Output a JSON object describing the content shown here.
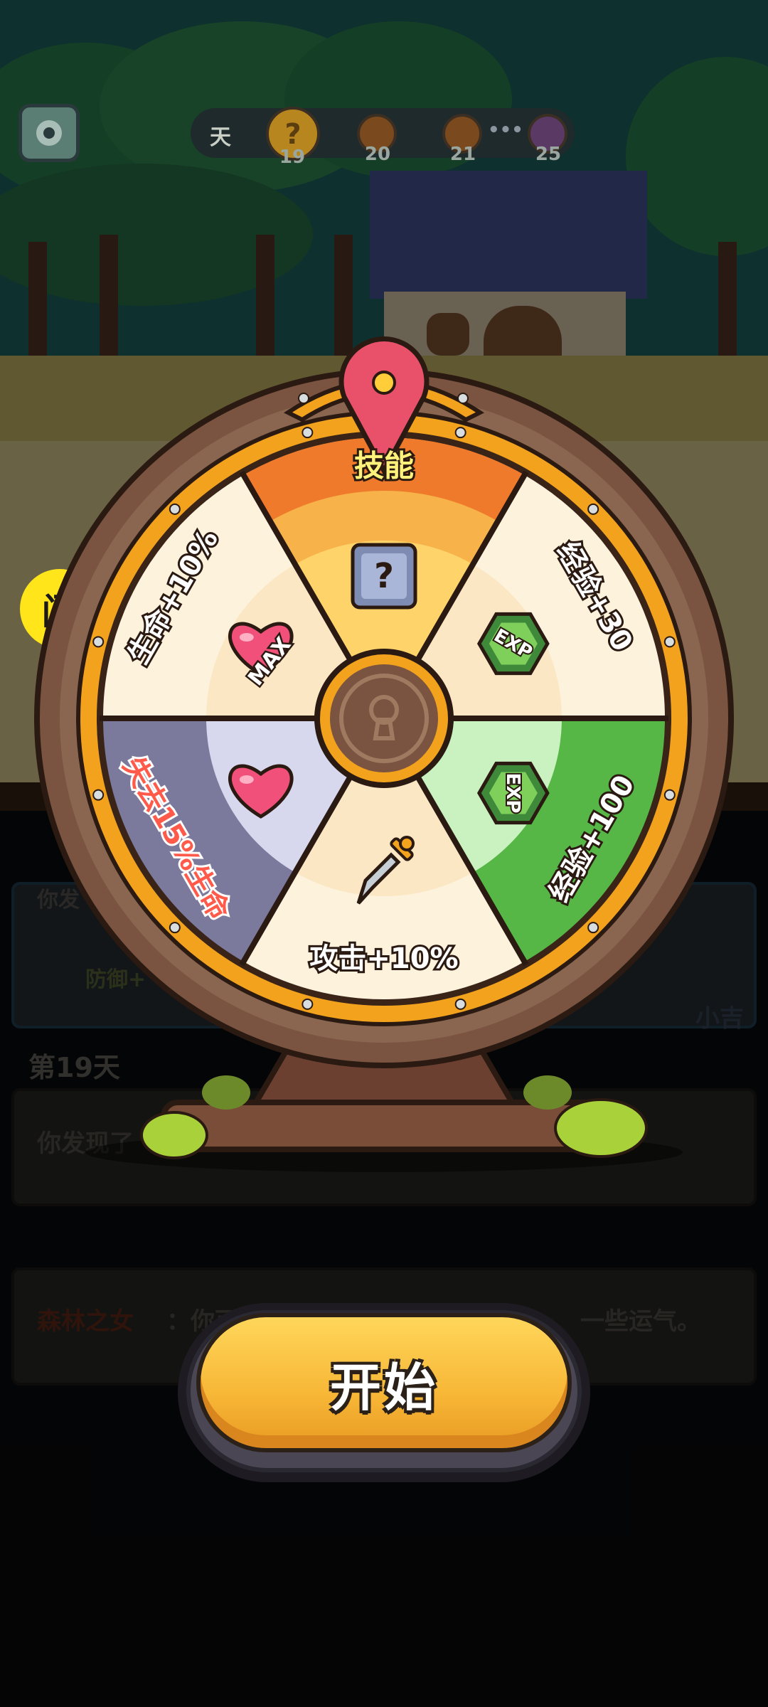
{
  "top_bar": {
    "day_label": "天",
    "day_nodes": [
      "19",
      "20",
      "21",
      "25"
    ],
    "ellipsis": "•••"
  },
  "wheel": {
    "segments": [
      {
        "label": "技能",
        "color": "#f7b24a",
        "icon": "mystery-box-icon"
      },
      {
        "label": "经验+30",
        "color": "#fdf2dc",
        "icon": "exp-gem-icon"
      },
      {
        "label": "经验+100",
        "color": "#56b646",
        "icon": "exp-gem-icon"
      },
      {
        "label": "攻击+10%",
        "color": "#fdf2dc",
        "icon": "sword-icon"
      },
      {
        "label": "失去15%生命",
        "color": "#7b7a9c",
        "icon": "heart-icon"
      },
      {
        "label": "生命+10%",
        "color": "#fdf2dc",
        "icon": "heart-max-icon"
      }
    ],
    "exp_badge": "EXP",
    "max_badge": "MAX",
    "mystery_mark": "?"
  },
  "flash_badge": "闪",
  "log": {
    "defense_label": "防御+",
    "xiaoji": "小吉",
    "day_title": "第19天",
    "found_text": "你发现了",
    "partial_text": "你发",
    "forest_speaker": "森林之女",
    "forest_text_a": "：你可",
    "forest_text_b": "一些运气。"
  },
  "start_button": {
    "label": "开始"
  },
  "colors": {
    "accent_orange": "#f7b636",
    "wheel_rim": "#f2a21c",
    "wheel_wood": "#7a5440",
    "pointer": "#e9506a"
  }
}
